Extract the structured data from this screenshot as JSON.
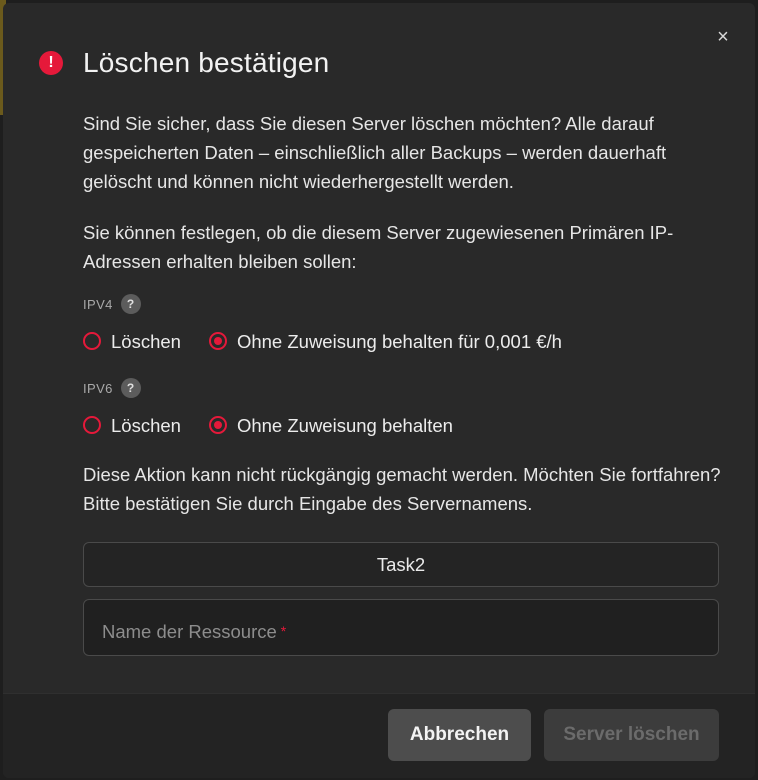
{
  "dialog": {
    "title": "Löschen bestätigen",
    "close_symbol": "×",
    "alert_symbol": "!",
    "paragraph1": "Sind Sie sicher, dass Sie diesen Server löschen möchten? Alle darauf gespeicherten Daten – einschließlich aller Backups – werden dauerhaft gelöscht und können nicht wiederhergestellt werden.",
    "paragraph2": "Sie können festlegen, ob die diesem Server zugewiesenen Primären IP-Adressen erhalten bleiben sollen:",
    "ipv4": {
      "label": "IPV4",
      "help_symbol": "?",
      "option_delete": "Löschen",
      "option_keep": "Ohne Zuweisung behalten für 0,001 €/h",
      "selected": "keep"
    },
    "ipv6": {
      "label": "IPV6",
      "help_symbol": "?",
      "option_delete": "Löschen",
      "option_keep": "Ohne Zuweisung behalten",
      "selected": "keep"
    },
    "paragraph3": "Diese Aktion kann nicht rückgängig gemacht werden. Möchten Sie fortfahren? Bitte bestätigen Sie durch Eingabe des Servernamens.",
    "server_name": "Task2",
    "input": {
      "placeholder": "Name der Ressource",
      "required_marker": "*",
      "value": ""
    },
    "buttons": {
      "cancel": "Abbrechen",
      "delete": "Server löschen"
    }
  },
  "colors": {
    "accent": "#e5193a",
    "modal_bg": "#292929",
    "footer_bg": "#232323"
  },
  "icons": {
    "close": "close-icon",
    "alert": "alert-circle-icon",
    "help": "help-circle-icon"
  }
}
